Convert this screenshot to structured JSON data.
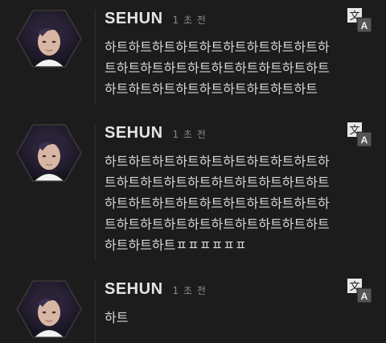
{
  "comments": [
    {
      "username": "SEHUN",
      "time": "1 초 전",
      "lines": [
        "하트하트하트하트하트하트하트하트하트하",
        "트하트하트하트하트하트하트하트하트하트",
        "하트하트하트하트하트하트하트하트하트"
      ]
    },
    {
      "username": "SEHUN",
      "time": "1 초 전",
      "lines": [
        "하트하트하트하트하트하트하트하트하트하",
        "트하트하트하트하트하트하트하트하트하트",
        "하트하트하트하트하트하트하트하트하트하",
        "트하트하트하트하트하트하트하트하트하트",
        "하트하트하트ㅍㅍㅍㅍㅍㅍ"
      ]
    },
    {
      "username": "SEHUN",
      "time": "1 초 전",
      "lines": [
        "하트"
      ]
    }
  ],
  "translate_icon": {
    "name": "translate-icon",
    "glyph_top": "文",
    "glyph_bottom": "A"
  },
  "colors": {
    "background": "#1c1c1c",
    "text": "#d6d6d6",
    "muted": "#8a8a8a",
    "avatar_border": "#3a3a3a"
  }
}
